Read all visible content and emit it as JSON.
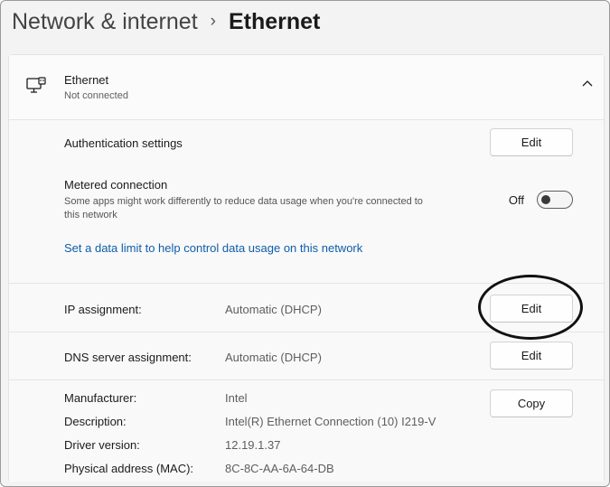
{
  "breadcrumb": {
    "parent": "Network & internet",
    "separator": "›",
    "current": "Ethernet"
  },
  "ethernet": {
    "title": "Ethernet",
    "status": "Not connected",
    "icon": "ethernet-pc-icon",
    "expand_icon": "chevron-up-icon"
  },
  "auth": {
    "label": "Authentication settings",
    "button": "Edit"
  },
  "metered": {
    "label": "Metered connection",
    "description": "Some apps might work differently to reduce data usage when you're connected to this network",
    "state": "Off"
  },
  "data_limit_link": "Set a data limit to help control data usage on this network",
  "ip": {
    "label": "IP assignment:",
    "value": "Automatic (DHCP)",
    "button": "Edit"
  },
  "dns": {
    "label": "DNS server assignment:",
    "value": "Automatic (DHCP)",
    "button": "Edit"
  },
  "properties": {
    "manufacturer_label": "Manufacturer:",
    "manufacturer": "Intel",
    "description_label": "Description:",
    "description": "Intel(R) Ethernet Connection (10) I219-V",
    "driver_label": "Driver version:",
    "driver": "12.19.1.37",
    "mac_label": "Physical address (MAC):",
    "mac": "8C-8C-AA-6A-64-DB",
    "copy_button": "Copy"
  }
}
